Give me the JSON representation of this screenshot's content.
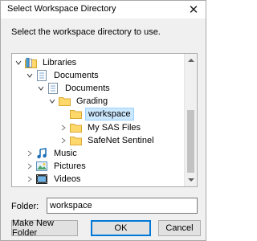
{
  "window": {
    "title": "Select Workspace Directory",
    "close_glyph": "✕"
  },
  "instruction": "Select the workspace directory to use.",
  "tree": {
    "items": [
      {
        "label": "Libraries",
        "icon": "libraries-icon",
        "expanded": true
      },
      {
        "label": "Documents",
        "icon": "library-documents-icon",
        "expanded": true
      },
      {
        "label": "Documents",
        "icon": "documents-icon",
        "expanded": true
      },
      {
        "label": "Grading",
        "icon": "folder-icon",
        "expanded": true
      },
      {
        "label": "workspace",
        "icon": "folder-icon",
        "expanded": false,
        "selected": true
      },
      {
        "label": "My SAS Files",
        "icon": "folder-icon",
        "expanded": false
      },
      {
        "label": "SafeNet Sentinel",
        "icon": "folder-icon",
        "expanded": false
      },
      {
        "label": "Music",
        "icon": "music-icon",
        "expanded": false
      },
      {
        "label": "Pictures",
        "icon": "pictures-icon",
        "expanded": false
      },
      {
        "label": "Videos",
        "icon": "videos-icon",
        "expanded": false
      }
    ]
  },
  "folder": {
    "label": "Folder:",
    "value": "workspace"
  },
  "buttons": {
    "new_folder": "Make New Folder",
    "ok": "OK",
    "cancel": "Cancel"
  },
  "colors": {
    "selection_bg": "#cce8ff",
    "selection_border": "#99d1ff",
    "default_button_border": "#0078d7",
    "folder_yellow": "#ffd86b"
  }
}
